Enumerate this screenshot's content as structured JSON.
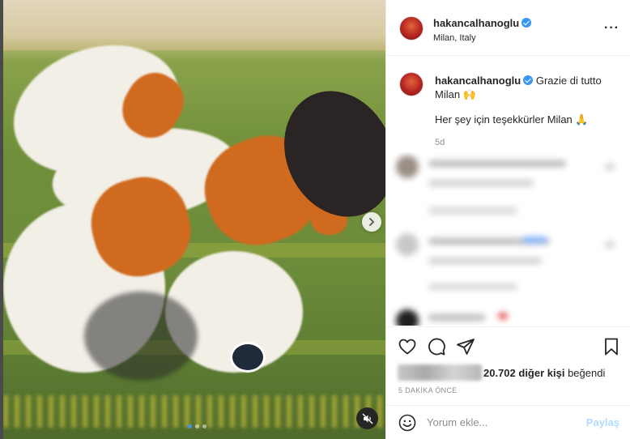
{
  "post": {
    "username": "hakancalhanoglu",
    "location": "Milan, Italy",
    "more_icon": "more-horizontal-icon",
    "media": {
      "slide_count": 3,
      "active_slide": 1,
      "next_icon": "chevron-right-icon",
      "mute_icon": "speaker-muted-icon"
    }
  },
  "caption": {
    "username": "hakancalhanoglu",
    "text_line1": "Grazie di tutto",
    "text_line2": "Milan 🙌",
    "text_tr": "Her şey için teşekkürler Milan 🙏",
    "age": "5d"
  },
  "actions": {
    "like_icon": "heart-icon",
    "comment_icon": "comment-bubble-icon",
    "share_icon": "paper-plane-icon",
    "save_icon": "bookmark-icon",
    "likes_count_text": "20.702 diğer kişi",
    "likes_suffix": " beğendi",
    "posted_time": "5 DAKİKA ÖNCE"
  },
  "comment_form": {
    "emoji_icon": "smiley-icon",
    "placeholder": "Yorum ekle...",
    "submit_label": "Paylaş"
  },
  "colors": {
    "verified": "#3897f0",
    "share_disabled": "#b3dbff",
    "text": "#262626",
    "muted": "#8e8e8e"
  }
}
